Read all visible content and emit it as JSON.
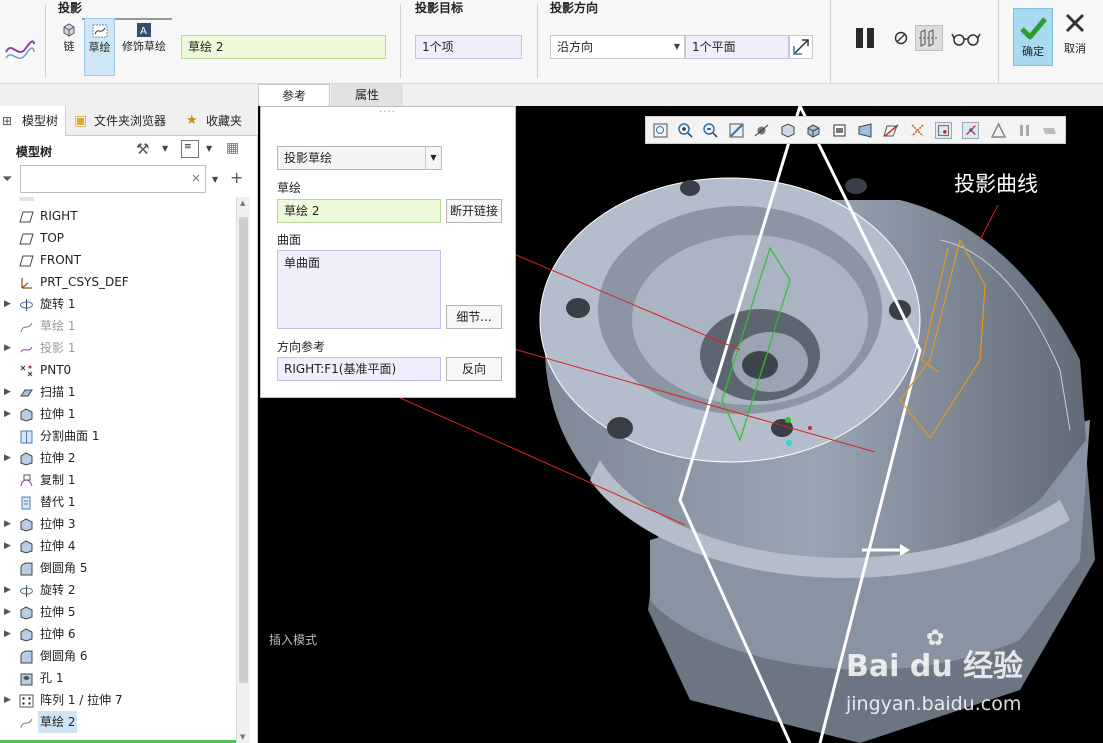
{
  "ribbon": {
    "group_projection": "投影",
    "chain_label": "链",
    "sketch_label": "草绘",
    "cosmetic_sketch_label": "修饰草绘",
    "sketch_field_value": "草绘 2",
    "group_target": "投影目标",
    "target_field_value": "1个项",
    "group_direction": "投影方向",
    "direction_select_value": "沿方向",
    "direction_ref_value": "1个平面",
    "ok_label": "确定",
    "cancel_label": "取消"
  },
  "tabs": [
    {
      "label": "参考"
    },
    {
      "label": "属性"
    }
  ],
  "model_tree": {
    "tab_model_tree": "模型树",
    "tab_folder_browser": "文件夹浏览器",
    "tab_favorites": "收藏夹",
    "header": "模型树",
    "filter_placeholder": "",
    "items": [
      {
        "label": "RIGHT",
        "icon": "datum-plane-icon",
        "expandable": false,
        "state": "normal"
      },
      {
        "label": "TOP",
        "icon": "datum-plane-icon",
        "expandable": false,
        "state": "normal"
      },
      {
        "label": "FRONT",
        "icon": "datum-plane-icon",
        "expandable": false,
        "state": "normal"
      },
      {
        "label": "PRT_CSYS_DEF",
        "icon": "csys-icon",
        "expandable": false,
        "state": "normal"
      },
      {
        "label": "旋转 1",
        "icon": "revolve-icon",
        "expandable": true,
        "state": "normal"
      },
      {
        "label": "草绘 1",
        "icon": "sketch-icon",
        "expandable": false,
        "state": "dim"
      },
      {
        "label": "投影 1",
        "icon": "projection-icon",
        "expandable": true,
        "state": "dim"
      },
      {
        "label": "PNT0",
        "icon": "datum-point-icon",
        "expandable": false,
        "state": "normal"
      },
      {
        "label": "扫描 1",
        "icon": "sweep-icon",
        "expandable": true,
        "state": "normal"
      },
      {
        "label": "拉伸 1",
        "icon": "extrude-icon",
        "expandable": true,
        "state": "normal"
      },
      {
        "label": "分割曲面 1",
        "icon": "split-surface-icon",
        "expandable": false,
        "state": "normal"
      },
      {
        "label": "拉伸 2",
        "icon": "extrude-icon",
        "expandable": true,
        "state": "normal"
      },
      {
        "label": "复制 1",
        "icon": "copy-icon",
        "expandable": false,
        "state": "normal"
      },
      {
        "label": "替代 1",
        "icon": "replace-icon",
        "expandable": false,
        "state": "normal"
      },
      {
        "label": "拉伸 3",
        "icon": "extrude-icon",
        "expandable": true,
        "state": "normal"
      },
      {
        "label": "拉伸 4",
        "icon": "extrude-icon",
        "expandable": true,
        "state": "normal"
      },
      {
        "label": "倒圆角 5",
        "icon": "round-icon",
        "expandable": false,
        "state": "normal"
      },
      {
        "label": "旋转 2",
        "icon": "revolve-icon",
        "expandable": true,
        "state": "normal"
      },
      {
        "label": "拉伸 5",
        "icon": "extrude-icon",
        "expandable": true,
        "state": "normal"
      },
      {
        "label": "拉伸 6",
        "icon": "extrude-icon",
        "expandable": true,
        "state": "normal"
      },
      {
        "label": "倒圆角 6",
        "icon": "round-icon",
        "expandable": false,
        "state": "normal"
      },
      {
        "label": "孔 1",
        "icon": "hole-icon",
        "expandable": false,
        "state": "normal"
      },
      {
        "label": "阵列 1 / 拉伸 7",
        "icon": "pattern-icon",
        "expandable": true,
        "state": "normal"
      },
      {
        "label": "草绘 2",
        "icon": "sketch-icon",
        "expandable": false,
        "state": "selected"
      }
    ]
  },
  "panel": {
    "type_select_value": "投影草绘",
    "sketch_label": "草绘",
    "sketch_value": "草绘 2",
    "break_link_label": "断开链接",
    "surface_label": "曲面",
    "surface_value": "单曲面",
    "details_label": "细节...",
    "direction_ref_label": "方向参考",
    "direction_ref_value": "RIGHT:F1(基准平面)",
    "flip_label": "反向"
  },
  "viewport": {
    "insert_mode_text": "插入模式",
    "annotation_text": "投影曲线",
    "watermark_brand": "Bai du 经验",
    "watermark_url": "jingyan.baidu.com"
  },
  "colors": {
    "selected_tile": "#cfe6f7",
    "ok_bg": "#a9d9f0",
    "model_surface": "#a7b2c1",
    "annotation_line": "#e02020",
    "projected_curve": "#e39a1f",
    "sketch_curve": "#2ec22e"
  }
}
